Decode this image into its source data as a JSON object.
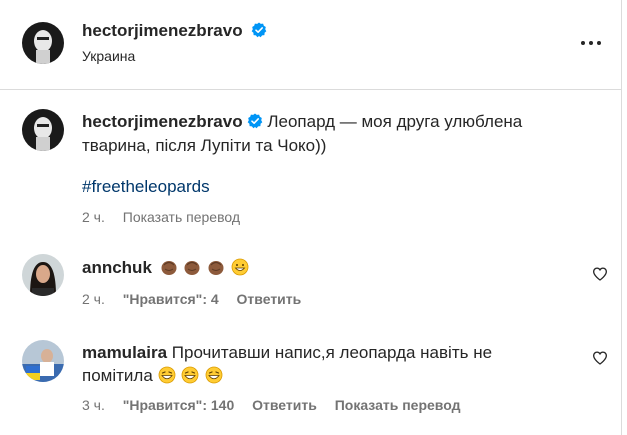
{
  "post": {
    "author": "hectorjimenezbravo",
    "location": "Украина",
    "caption": "Леопард — моя друга улюблена тварина, після Лупіти та Чоко))",
    "hashtag": "#freetheleopards",
    "time": "2 ч.",
    "translate": "Показать перевод"
  },
  "comments": [
    {
      "username": "annchuk",
      "text": "",
      "emojis": [
        "clapping-hands-dark",
        "clapping-hands-dark",
        "clapping-hands-dark",
        "grinning-face"
      ],
      "time": "2 ч.",
      "likes": "\"Нравится\": 4",
      "reply": "Ответить"
    },
    {
      "username": "mamulaira",
      "text_line1": "Прочитавши напис,я леопарда навіть не",
      "text_line2": "помітила",
      "emojis": [
        "laughing-face",
        "laughing-face",
        "laughing-face"
      ],
      "time": "3 ч.",
      "likes": "\"Нравится\": 140",
      "reply": "Ответить",
      "translate": "Показать перевод"
    }
  ],
  "colors": {
    "text": "#262626",
    "secondary": "#737373",
    "hashtag": "#00376b",
    "verified": "#0095f6",
    "divider": "#dbdbdb"
  },
  "icons": [
    "verified-badge-icon",
    "more-options-icon",
    "heart-icon"
  ]
}
